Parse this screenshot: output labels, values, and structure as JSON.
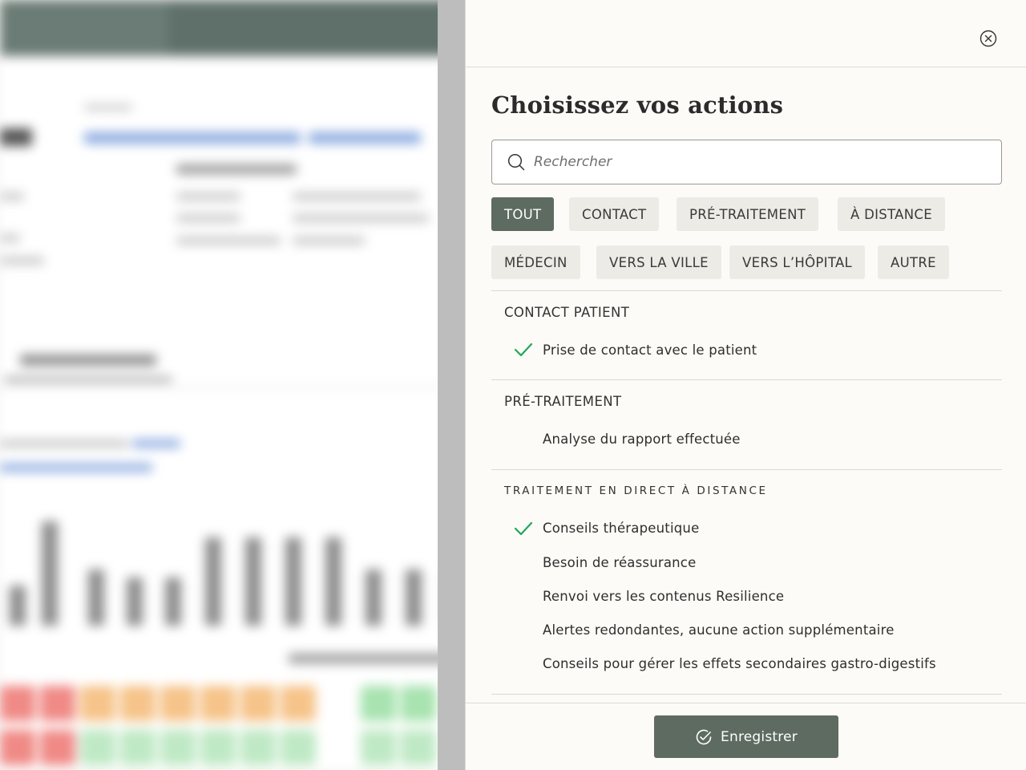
{
  "panel": {
    "title": "Choisissez vos actions",
    "close_icon": "close-circle-icon"
  },
  "search": {
    "placeholder": "Rechercher",
    "icon": "search-icon"
  },
  "filters": [
    {
      "label": "TOUT",
      "active": true
    },
    {
      "label": "CONTACT",
      "active": false
    },
    {
      "label": "PRÉ-TRAITEMENT",
      "active": false
    },
    {
      "label": "À DISTANCE",
      "active": false
    },
    {
      "label": "MÉDECIN",
      "active": false
    },
    {
      "label": "VERS LA VILLE",
      "active": false
    },
    {
      "label": "VERS L’HÔPITAL",
      "active": false
    },
    {
      "label": "AUTRE",
      "active": false
    }
  ],
  "sections": [
    {
      "title": "CONTACT PATIENT",
      "actions": [
        {
          "label": "Prise de contact avec le patient",
          "checked": true
        }
      ]
    },
    {
      "title": "PRÉ-TRAITEMENT",
      "actions": [
        {
          "label": "Analyse du rapport effectuée",
          "checked": false
        }
      ]
    },
    {
      "title": "TRAITEMENT EN DIRECT À DISTANCE",
      "actions": [
        {
          "label": "Conseils thérapeutique",
          "checked": true
        },
        {
          "label": "Besoin de réassurance",
          "checked": false
        },
        {
          "label": "Renvoi vers les contenus Resilience",
          "checked": false
        },
        {
          "label": "Alertes redondantes, aucune action supplémentaire",
          "checked": false
        },
        {
          "label": "Conseils pour gérer les effets secondaires gastro-digestifs",
          "checked": false
        }
      ]
    }
  ],
  "footer": {
    "save_label": "Enregistrer",
    "save_icon": "check-circle-icon"
  },
  "colors": {
    "accent": "#5e6b61",
    "check": "#1fa85a",
    "chip_bg": "#ecebe5",
    "panel_bg": "#fcfbf7"
  }
}
